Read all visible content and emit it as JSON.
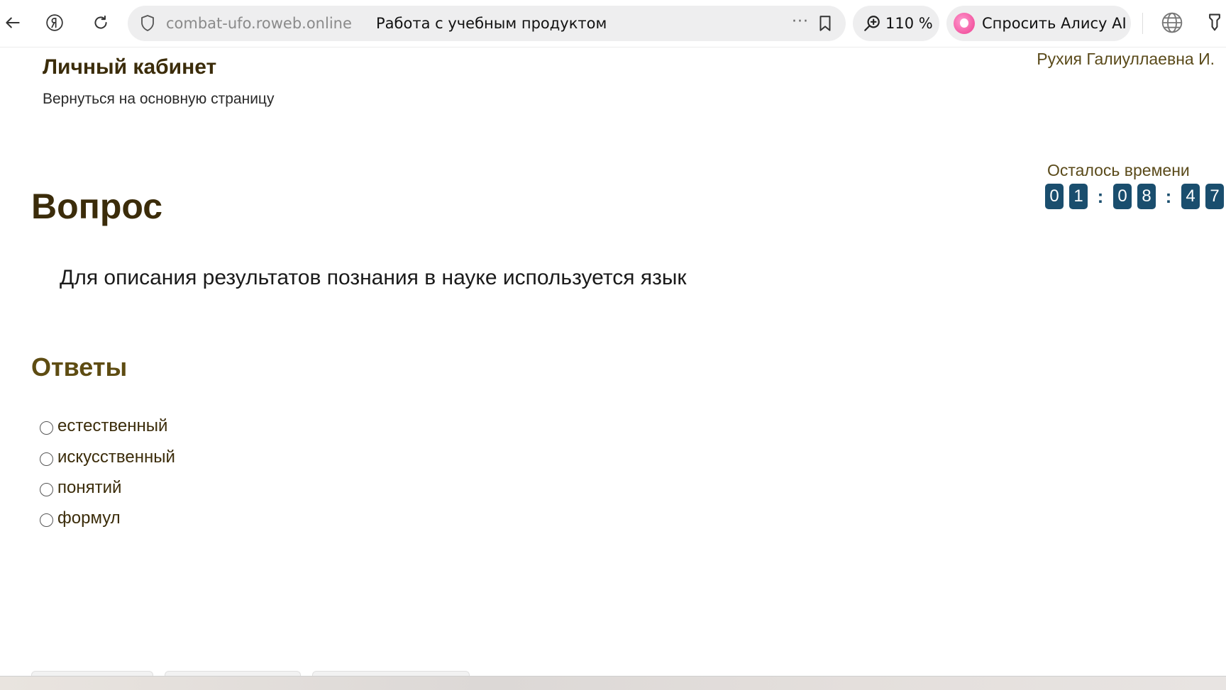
{
  "browser": {
    "url": "combat-ufo.roweb.online",
    "tab_title": "Работа с учебным продуктом",
    "more_label": "···",
    "zoom": "110 %",
    "alice_label": "Спросить Алису AI"
  },
  "header": {
    "title": "Личный кабинет",
    "back_link": "Вернуться на основную страницу",
    "user_name": "Рухия Галиуллаевна И."
  },
  "timer": {
    "label": "Осталось времени",
    "digits": [
      "0",
      "1",
      "0",
      "8",
      "4",
      "7"
    ],
    "separator": ":"
  },
  "question": {
    "heading": "Вопрос",
    "text": "Для описания результатов познания в науке используется язык"
  },
  "answers": {
    "heading": "Ответы",
    "options": [
      {
        "label": "естественный"
      },
      {
        "label": "искусственный"
      },
      {
        "label": "понятий"
      },
      {
        "label": "формул"
      }
    ]
  },
  "colors": {
    "heading": "#3b2c0a",
    "answers_heading": "#5e4c12",
    "timer_digit_bg": "#1a4e6e",
    "alice_accent": "#ee3d8f"
  }
}
